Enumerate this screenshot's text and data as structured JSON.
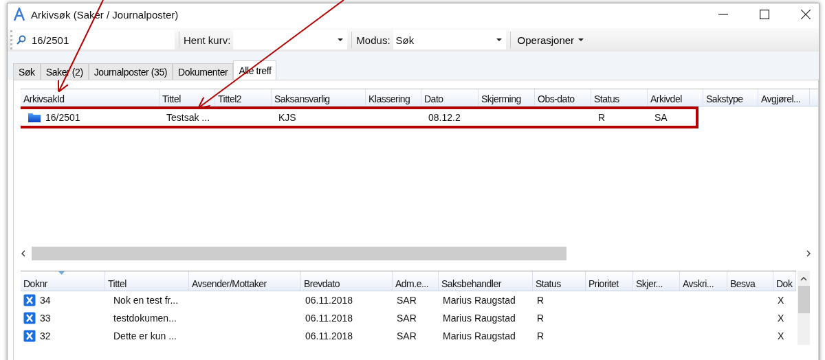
{
  "window": {
    "title": "Arkivsøk (Saker / Journalposter)"
  },
  "toolbar": {
    "search": {
      "value": "16/2501"
    },
    "basket": {
      "label": "Hent kurv:"
    },
    "mode": {
      "label": "Modus:",
      "value": "Søk"
    },
    "operations": "Operasjoner"
  },
  "tabs": [
    {
      "label": "Søk",
      "selected": false
    },
    {
      "label": "Saker (2)",
      "selected": false
    },
    {
      "label": "Journalposter (35)",
      "selected": false
    },
    {
      "label": "Dokumenter",
      "selected": false
    },
    {
      "label": "Alle treff",
      "selected": true
    }
  ],
  "cases": {
    "columns": [
      "ArkivsakId",
      "Tittel",
      "Tittel2",
      "Saksansvarlig",
      "Klassering",
      "Dato",
      "Skjerming",
      "Obs-dato",
      "Status",
      "Arkivdel",
      "Sakstype",
      "Avgjørel..."
    ],
    "rows": [
      {
        "kind": "folder",
        "highlighted": true,
        "cells": [
          "16/2501",
          "Testsak ...",
          "",
          "KJS",
          "",
          "08.12.2",
          "",
          "",
          "R",
          "SA",
          "",
          ""
        ]
      }
    ]
  },
  "documents": {
    "columns": [
      {
        "label": "Doknr",
        "sorted": true
      },
      {
        "label": "Tittel",
        "sorted": false
      },
      {
        "label": "Avsender/Mottaker",
        "sorted": false
      },
      {
        "label": "Brevdato",
        "sorted": false
      },
      {
        "label": "Adm.e...",
        "sorted": false
      },
      {
        "label": "Saksbehandler",
        "sorted": false
      },
      {
        "label": "Status",
        "sorted": false
      },
      {
        "label": "Prioritet",
        "sorted": false
      },
      {
        "label": "Skjer...",
        "sorted": false
      },
      {
        "label": "Avskri...",
        "sorted": false
      },
      {
        "label": "Besva",
        "sorted": false
      },
      {
        "label": "Dok",
        "sorted": false
      }
    ],
    "rows": [
      {
        "kind": "x-doc",
        "cells": [
          "34",
          "Nok en test fr...",
          "",
          "06.11.2018",
          "SAR",
          "Marius Raugstad",
          "R",
          "",
          "",
          "",
          "",
          "X"
        ]
      },
      {
        "kind": "x-doc",
        "cells": [
          "33",
          "testdokumen...",
          "",
          "06.11.2018",
          "SAR",
          "Marius Raugstad",
          "R",
          "",
          "",
          "",
          "",
          "X"
        ]
      },
      {
        "kind": "x-doc",
        "cells": [
          "32",
          "Dette er kun ...",
          "",
          "06.11.2018",
          "SAR",
          "Marius Raugstad",
          "R",
          "",
          "",
          "",
          "",
          "X"
        ]
      }
    ]
  }
}
